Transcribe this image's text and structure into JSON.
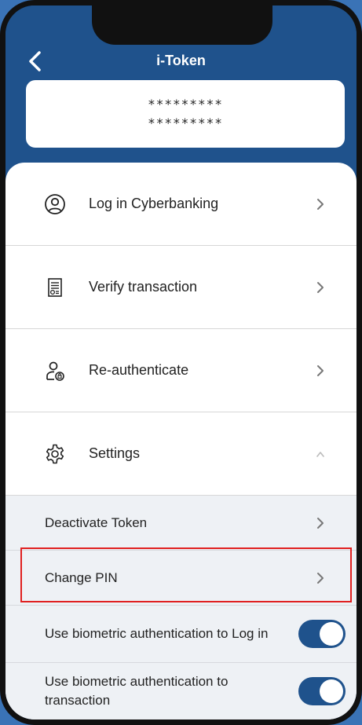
{
  "header": {
    "title": "i-Token",
    "token_line_1": "*********",
    "token_line_2": "*********"
  },
  "menu": {
    "items": [
      {
        "label": "Log in Cyberbanking",
        "icon": "user-circle-icon"
      },
      {
        "label": "Verify transaction",
        "icon": "document-check-icon"
      },
      {
        "label": "Re-authenticate",
        "icon": "user-lock-icon"
      },
      {
        "label": "Settings",
        "icon": "gear-icon",
        "expanded": true
      }
    ]
  },
  "settings": {
    "items": [
      {
        "label": "Deactivate Token"
      },
      {
        "label": "Change PIN",
        "highlighted": true
      },
      {
        "label": "Use biometric authentication to Log in",
        "toggle": true
      },
      {
        "label": "Use biometric authentication to transaction",
        "toggle": true
      }
    ]
  },
  "colors": {
    "brand_blue": "#1f528c",
    "highlight_red": "#e02020"
  }
}
